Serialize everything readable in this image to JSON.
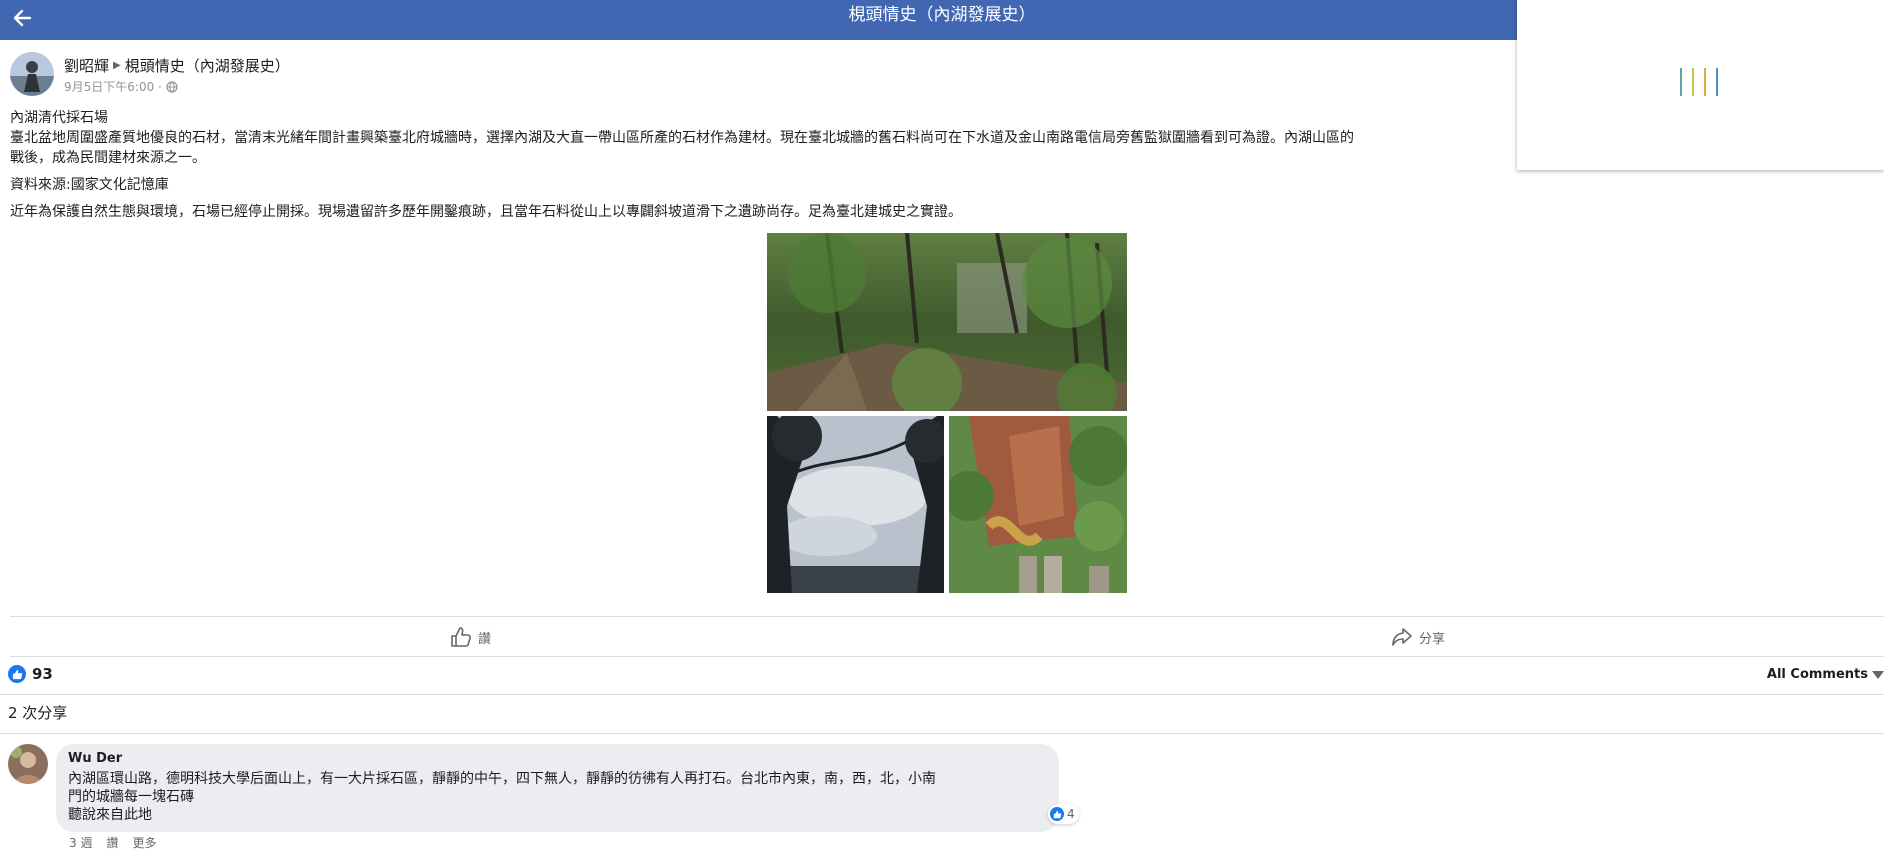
{
  "header": {
    "title": "梘頭情史（內湖發展史）",
    "back_icon": "arrow-left-icon",
    "bar_color": "#4267b2"
  },
  "post": {
    "author": "劉昭輝",
    "group": "梘頭情史（內湖發展史）",
    "time": "9月5日下午6:00 ·",
    "privacy_icon": "globe-icon",
    "text": [
      "內湖清代採石場",
      "臺北盆地周圍盛產質地優良的石材，當清末光緒年間計畫興築臺北府城牆時，選擇內湖及大直一帶山區所產的石材作為建材。現在臺北城牆的舊石料尚可在下水道及金山南路電信局旁舊監獄圍牆看到可為證。內湖山區的",
      "戰後，成為民間建材來源之一。",
      "資料來源:國家文化記憶庫",
      "近年為保護自然生態與環境，石場已經停止開採。現場遺留許多歷年開鑿痕跡，且當年石料從山上以專闢斜坡道滑下之遺跡尚存。足為臺北建城史之實證。"
    ],
    "photos": [
      "forest-trail-photo",
      "sky-through-trees-photo",
      "quarry-cliff-photo"
    ]
  },
  "actions": {
    "like_label": "讚",
    "share_label": "分享"
  },
  "stats": {
    "reaction_count": "93",
    "comments_filter": "All Comments",
    "shares": "2 次分享"
  },
  "comment": {
    "author": "Wu Der",
    "lines": [
      "內湖區環山路，德明科技大學后面山上，有一大片採石區，靜靜的中午，四下無人，靜靜的彷彿有人再打石。台北市內東，南，西，北，小南",
      "門的城牆每一塊石磚",
      "聽說來自此地"
    ],
    "reactions": "4",
    "time": "3 週",
    "like": "讚",
    "more": "更多"
  },
  "colors": {
    "accent": "#4267b2",
    "like_blue": "#1877f2"
  }
}
